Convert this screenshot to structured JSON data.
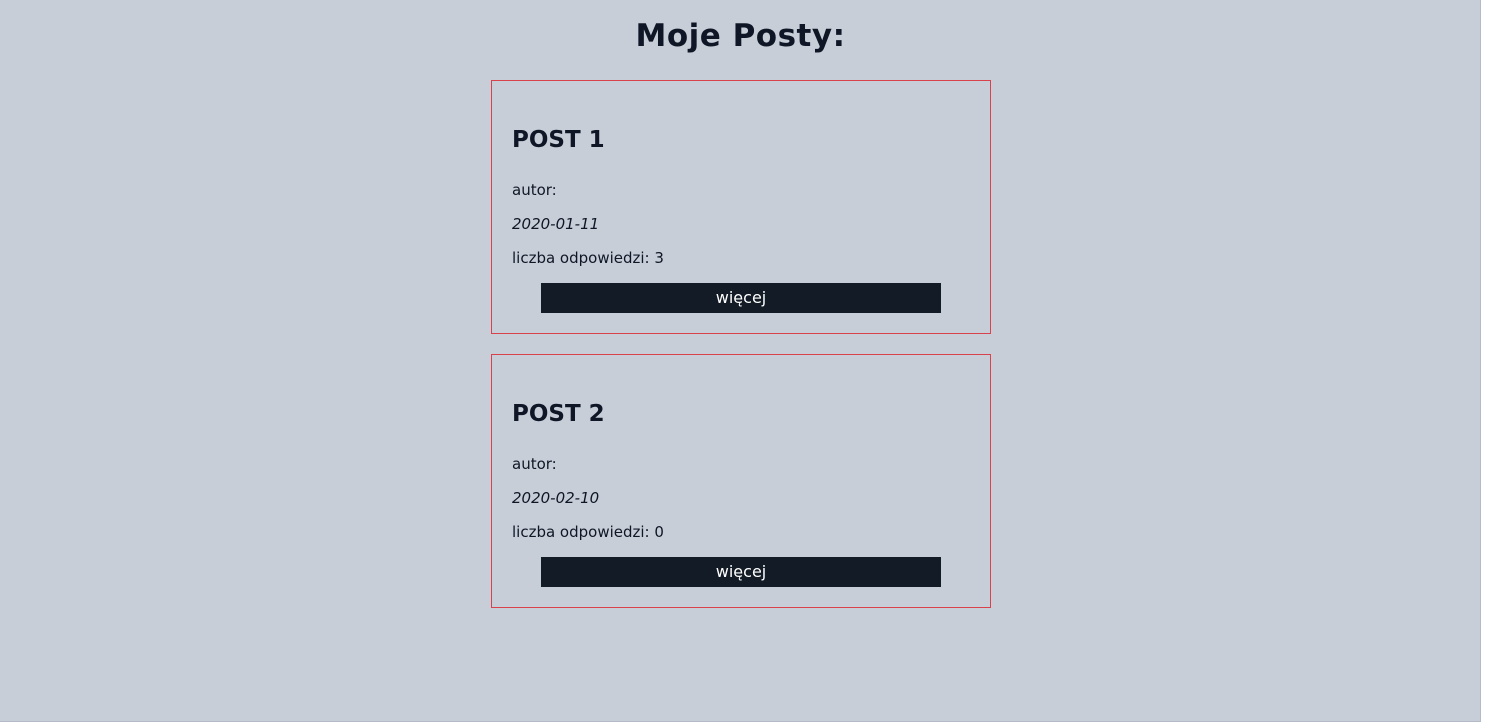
{
  "page": {
    "title": "Moje Posty:"
  },
  "posts": [
    {
      "title": "POST 1",
      "author_label": "autor:",
      "date": "2020-01-11",
      "replies": "liczba odpowiedzi: 3",
      "button_label": "więcej"
    },
    {
      "title": "POST 2",
      "author_label": "autor:",
      "date": "2020-02-10",
      "replies": "liczba odpowiedzi: 0",
      "button_label": "więcej"
    }
  ],
  "colors": {
    "background": "#c7ced8",
    "text": "#0f1727",
    "card_border": "#d9414b",
    "button_bg": "#131c26",
    "button_text": "#ffffff"
  }
}
